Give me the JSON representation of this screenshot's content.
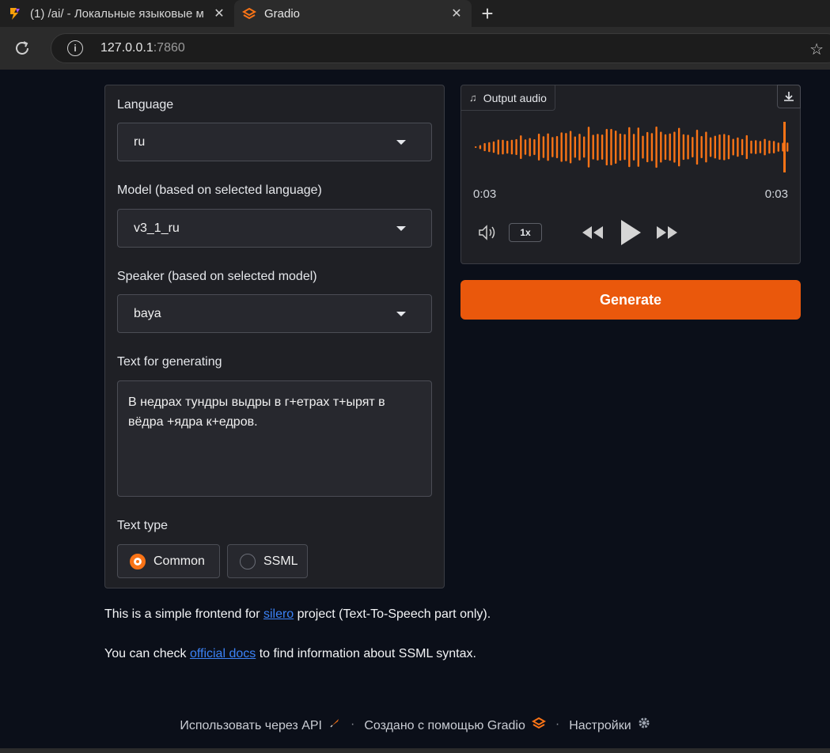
{
  "browser": {
    "tabs": [
      {
        "title": "(1) /ai/ - Локальные языковые м",
        "icon": "lightning-icon",
        "active": false
      },
      {
        "title": "Gradio",
        "icon": "gradio-logo-icon",
        "active": true
      }
    ],
    "url_host": "127.0.0.1",
    "url_port": ":7860"
  },
  "form": {
    "language_label": "Language",
    "language_value": "ru",
    "model_label": "Model (based on selected language)",
    "model_value": "v3_1_ru",
    "speaker_label": "Speaker (based on selected model)",
    "speaker_value": "baya",
    "text_label": "Text for generating",
    "text_value": "В недрах тундры выдры в г+етрах т+ырят в вёдра +ядра к+едров.",
    "text_type_label": "Text type",
    "text_type_options": [
      "Common",
      "SSML"
    ],
    "text_type_selected": "Common"
  },
  "audio": {
    "label": "Output audio",
    "time_current": "0:03",
    "time_total": "0:03",
    "speed": "1x",
    "progress": 1.0,
    "accent_color": "#f97316"
  },
  "generate_label": "Generate",
  "description": {
    "line1_pre": "This is a simple frontend for ",
    "line1_link": "silero",
    "line1_post": " project (Text-To-Speech part only).",
    "line2_pre": "You can check ",
    "line2_link": "official docs",
    "line2_post": " to find information about SSML syntax."
  },
  "footer": {
    "api": "Использовать через API",
    "built": "Создано с помощью Gradio",
    "settings": "Настройки"
  }
}
